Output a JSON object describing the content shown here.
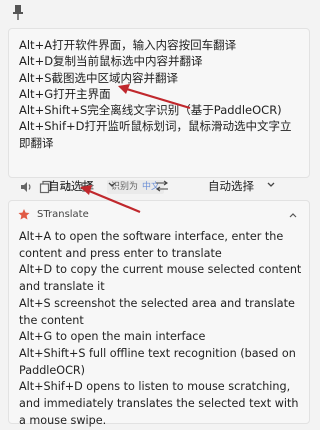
{
  "input": {
    "text": "Alt+A打开软件界面，输入内容按回车翻译\nAlt+D复制当前鼠标选中内容并翻译\nAlt+S截图选中区域内容并翻译\nAlt+G打开主界面\nAlt+Shift+S完全离线文字识别（基于PaddleOCR)\nAlt+Shif+D打开监听鼠标划词，鼠标滑动选中文字立即翻译",
    "detected_prefix": "识别为",
    "detected_lang": "中文"
  },
  "lang": {
    "source": "自动选择",
    "target": "自动选择"
  },
  "result": {
    "service": "STranslate",
    "text": "Alt+A to open the software interface, enter the content and press enter to translate\nAlt+D to copy the current mouse selected content and translate it\nAlt+S screenshot the selected area and translate the content\nAlt+G to open the main interface\nAlt+Shift+S full offline text recognition (based on PaddleOCR)\nAlt+Shif+D opens to listen to mouse scratching, and immediately translates the selected text with a mouse swipe."
  },
  "colors": {
    "accent": "#6c8fd6",
    "arrow": "#c0282d",
    "logo": "#e15b45"
  },
  "icons": [
    "pin-icon",
    "speaker-icon",
    "copy-icon",
    "snake-case-icon",
    "cancel-format-icon",
    "chevron-down-icon",
    "swap-icon",
    "stranslate-logo-icon"
  ]
}
